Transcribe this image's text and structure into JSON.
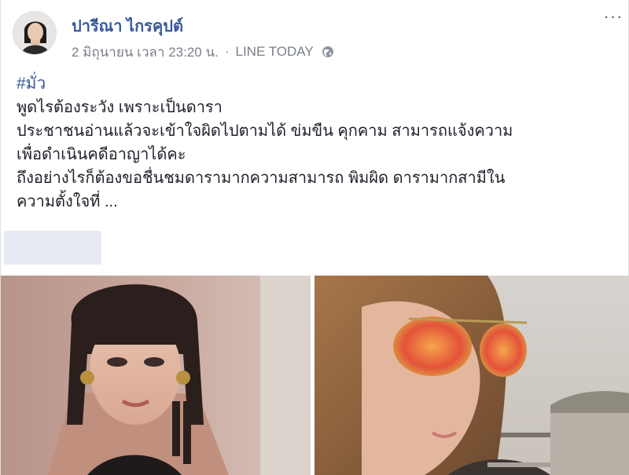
{
  "post": {
    "author": "ปารีณา ไกรคุปต์",
    "date": "2 มิถุนายน เวลา 23:20 น.",
    "separator": "·",
    "source": "LINE TODAY",
    "menu_label": "···",
    "hashtag": "#มั่ว",
    "lines": [
      "พูดไรต้องระวัง เพราะเป็นดารา",
      "ประชาชนอ่านแล้วจะเข้าใจผิดไปตามได้ ข่มขืน คุกคาม สามารถแจ้งความ",
      "เพื่อดำเนินคดีอาญาได้คะ",
      "ถึงอย่างไรก็ต้องขอชื่นชมดารามากความสามารถ พิมผิด ดารามากสามีใน",
      "ความตั้งใจที่ ..."
    ]
  },
  "icons": {
    "privacy": "globe-icon",
    "menu": "more-options-icon"
  },
  "colors": {
    "author_link": "#365899",
    "meta_text": "#7a7f87",
    "body_text": "#1d2129",
    "redacted_box": "#e7ebf3"
  }
}
